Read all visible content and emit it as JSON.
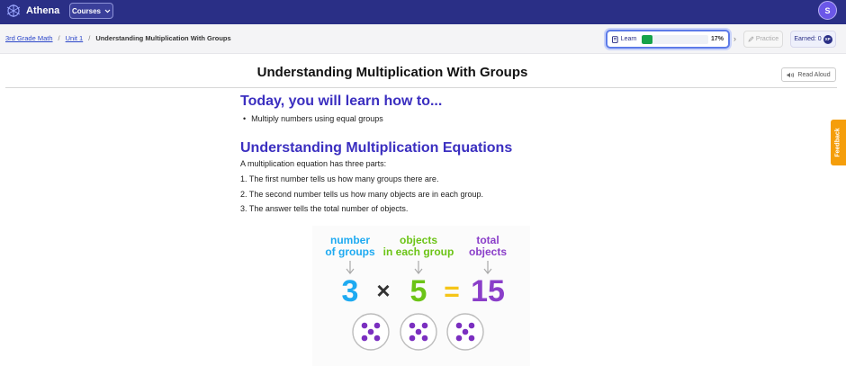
{
  "header": {
    "app_name": "Athena",
    "courses_label": "Courses",
    "avatar_initial": "S"
  },
  "breadcrumb": {
    "items": [
      "3rd Grade Math",
      "Unit 1"
    ],
    "separator": "/",
    "current": "Understanding Multiplication With Groups"
  },
  "progress": {
    "learn_label": "Learn",
    "learn_fraction": 0.17,
    "learn_percent_text": "17%",
    "practice_label": "Practice",
    "earned_label": "Earned: 0",
    "xp_badge": "XP"
  },
  "page": {
    "title": "Understanding Multiplication With Groups",
    "read_aloud_label": "Read Aloud"
  },
  "content": {
    "section1_heading": "Today, you will learn how to...",
    "section1_bullets": [
      "Multiply numbers using equal groups"
    ],
    "section2_heading": "Understanding Multiplication Equations",
    "intro": "A multiplication equation has three parts:",
    "steps": [
      "1. The first number tells us how many groups there are.",
      "2. The second number tells us how many objects are in each group.",
      "3. The answer tells the total number of objects."
    ]
  },
  "figure": {
    "label_groups_line1": "number",
    "label_groups_line2": "of groups",
    "label_objects_line1": "objects",
    "label_objects_line2": "in each group",
    "label_total_line1": "total",
    "label_total_line2": "objects",
    "num_groups": "3",
    "times": "×",
    "num_objects": "5",
    "equals": "=",
    "total": "15",
    "color_groups": "#1eaaf1",
    "color_objects": "#6cc417",
    "color_total": "#8a3ec9",
    "color_equals": "#f5c518",
    "dot_color": "#7b2fc0"
  },
  "feedback_label": "Feedback",
  "colors": {
    "topbar": "#2a2f86",
    "heading": "#3b2fc0",
    "progress_fill": "#17a34a",
    "feedback_tab": "#f59e0b"
  }
}
